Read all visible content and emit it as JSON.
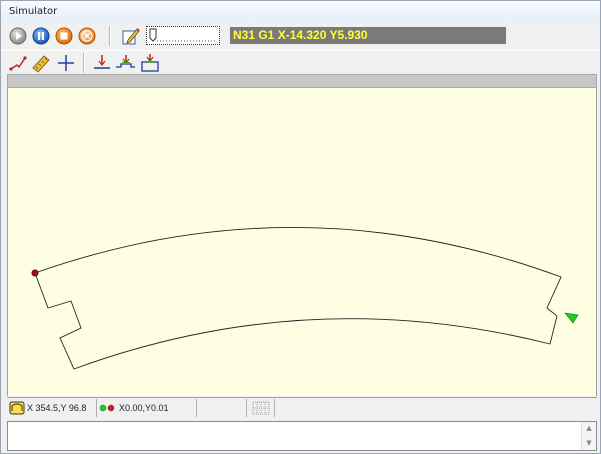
{
  "window": {
    "title": "Simulator"
  },
  "toolbar": {
    "nc_line": "N31 G1 X-14.320 Y5.930",
    "buttons": [
      {
        "name": "play-icon"
      },
      {
        "name": "pause-icon"
      },
      {
        "name": "stop-icon"
      },
      {
        "name": "cancel-icon"
      },
      {
        "name": "edit-icon"
      }
    ],
    "tools": [
      {
        "name": "path-icon"
      },
      {
        "name": "ruler-icon"
      },
      {
        "name": "crosshair-icon"
      },
      {
        "name": "baseline-icon"
      },
      {
        "name": "baseline-step-icon"
      },
      {
        "name": "baseline-frame-icon"
      }
    ]
  },
  "status": {
    "coords": "X 354.5,Y  96.8",
    "offset": "X0.00,Y0.01"
  },
  "colors": {
    "canvas": "#fefee2",
    "nc_bg": "#7a7a7a",
    "nc_text": "#ffff33",
    "start_marker": "#a01010",
    "tool_marker": "#22cc22"
  }
}
